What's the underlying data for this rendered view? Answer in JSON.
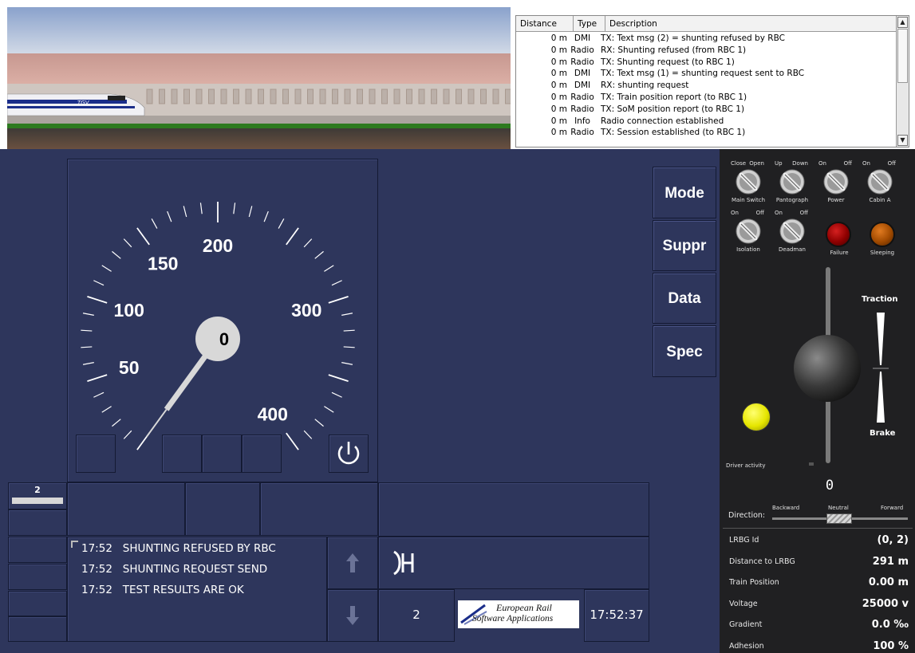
{
  "event_log": {
    "columns": [
      "Distance",
      "Type",
      "Description"
    ],
    "rows": [
      {
        "distance": "0 m",
        "type": "DMI",
        "description": "TX: Text msg (2) = shunting refused by RBC"
      },
      {
        "distance": "0 m",
        "type": "Radio",
        "description": "RX: Shunting refused (from RBC 1)"
      },
      {
        "distance": "0 m",
        "type": "Radio",
        "description": "TX: Shunting request (to RBC 1)"
      },
      {
        "distance": "0 m",
        "type": "DMI",
        "description": "TX: Text msg (1) = shunting request sent to RBC"
      },
      {
        "distance": "0 m",
        "type": "DMI",
        "description": "RX: shunting request"
      },
      {
        "distance": "0 m",
        "type": "Radio",
        "description": "TX: Train position report (to RBC 1)"
      },
      {
        "distance": "0 m",
        "type": "Radio",
        "description": "TX: SoM position report (to RBC 1)"
      },
      {
        "distance": "0 m",
        "type": "Info",
        "description": "Radio connection established"
      },
      {
        "distance": "0 m",
        "type": "Radio",
        "description": "TX: Session established (to RBC 1)"
      }
    ]
  },
  "scene": {
    "train_logo": "TGV"
  },
  "speedometer": {
    "current_speed": "0",
    "current_speed_value": 0,
    "max_scale": 400,
    "labels": [
      "50",
      "100",
      "150",
      "200",
      "300",
      "400"
    ]
  },
  "dmi": {
    "level_value": "2",
    "buttons": {
      "mode": "Mode",
      "suppr": "Suppr",
      "data": "Data",
      "spec": "Spec"
    },
    "messages": [
      {
        "time": "17:52",
        "text": "SHUNTING REFUSED BY RBC"
      },
      {
        "time": "17:52",
        "text": "SHUNTING REQUEST SEND"
      },
      {
        "time": "17:52",
        "text": "TEST RESULTS ARE OK"
      }
    ],
    "level_bottom": "2",
    "logo_line1": "European Rail",
    "logo_line2": "Software Applications",
    "clock": "17:52:37"
  },
  "control_panel": {
    "switches": [
      {
        "label": "Main Switch",
        "left": "Close",
        "right": "Open"
      },
      {
        "label": "Pantograph",
        "left": "Up",
        "right": "Down"
      },
      {
        "label": "Power",
        "left": "On",
        "right": "Off"
      },
      {
        "label": "Cabin A",
        "left": "On",
        "right": "Off"
      },
      {
        "label": "Isolation",
        "left": "On",
        "right": "Off"
      },
      {
        "label": "Deadman",
        "left": "On",
        "right": "Off"
      }
    ],
    "lamps": [
      {
        "label": "Failure",
        "color": "#8e0000"
      },
      {
        "label": "Sleeping",
        "color": "#a14a00"
      }
    ],
    "traction_label": "Traction",
    "brake_label": "Brake",
    "driver_activity_label": "Driver activity",
    "notch_value": "0",
    "direction": {
      "label": "Direction:",
      "backward": "Backward",
      "neutral": "Neutral",
      "forward": "Forward"
    },
    "info": [
      {
        "label": "LRBG Id",
        "value": "(0, 2)"
      },
      {
        "label": "Distance to LRBG",
        "value": "291  m"
      },
      {
        "label": "Train Position",
        "value": "0.00  m"
      },
      {
        "label": "Voltage",
        "value": "25000 v"
      },
      {
        "label": "Gradient",
        "value": "0.0 ‰"
      },
      {
        "label": "Adhesion",
        "value": "100 %"
      }
    ]
  },
  "colors": {
    "dmi_bg": "#2e365c",
    "panel_bg": "#202022",
    "activity_lamp": "#e6e600"
  }
}
